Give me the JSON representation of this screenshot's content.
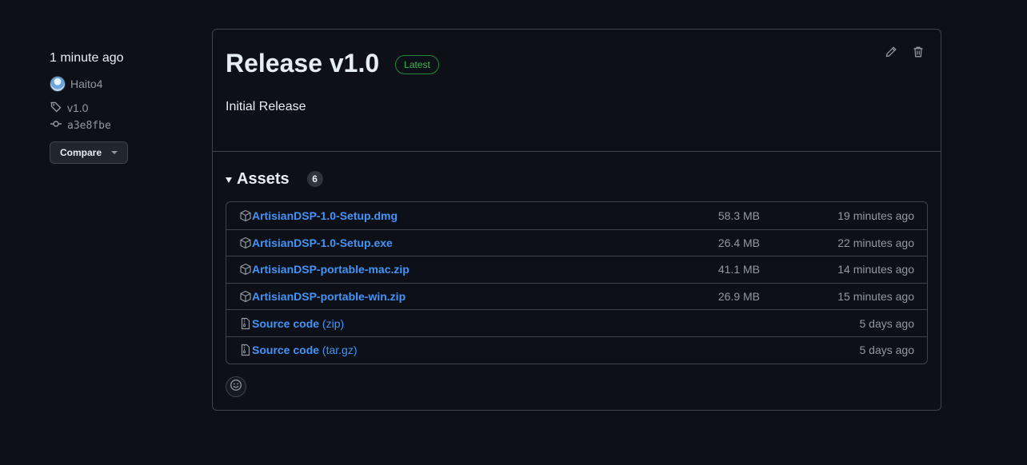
{
  "sidebar": {
    "time": "1 minute ago",
    "author": "Haito4",
    "tag": "v1.0",
    "commit": "a3e8fbe",
    "compare_label": "Compare"
  },
  "release": {
    "title": "Release v1.0",
    "badge": "Latest",
    "body": "Initial Release"
  },
  "assets": {
    "title": "Assets",
    "count": "6",
    "items": [
      {
        "name": "ArtisianDSP-1.0-Setup.dmg",
        "format": "",
        "size": "58.3 MB",
        "time": "19 minutes ago",
        "icon": "package-icon"
      },
      {
        "name": "ArtisianDSP-1.0-Setup.exe",
        "format": "",
        "size": "26.4 MB",
        "time": "22 minutes ago",
        "icon": "package-icon"
      },
      {
        "name": "ArtisianDSP-portable-mac.zip",
        "format": "",
        "size": "41.1 MB",
        "time": "14 minutes ago",
        "icon": "package-icon"
      },
      {
        "name": "ArtisianDSP-portable-win.zip",
        "format": "",
        "size": "26.9 MB",
        "time": "15 minutes ago",
        "icon": "package-icon"
      },
      {
        "name": "Source code",
        "format": "(zip)",
        "size": "",
        "time": "5 days ago",
        "icon": "file-zip-icon"
      },
      {
        "name": "Source code",
        "format": "(tar.gz)",
        "size": "",
        "time": "5 days ago",
        "icon": "file-zip-icon"
      }
    ]
  },
  "colors": {
    "background": "#0d1117",
    "link": "#4493f8",
    "latest": "#3fb950",
    "muted": "#9198a1",
    "border": "#3d444d"
  }
}
